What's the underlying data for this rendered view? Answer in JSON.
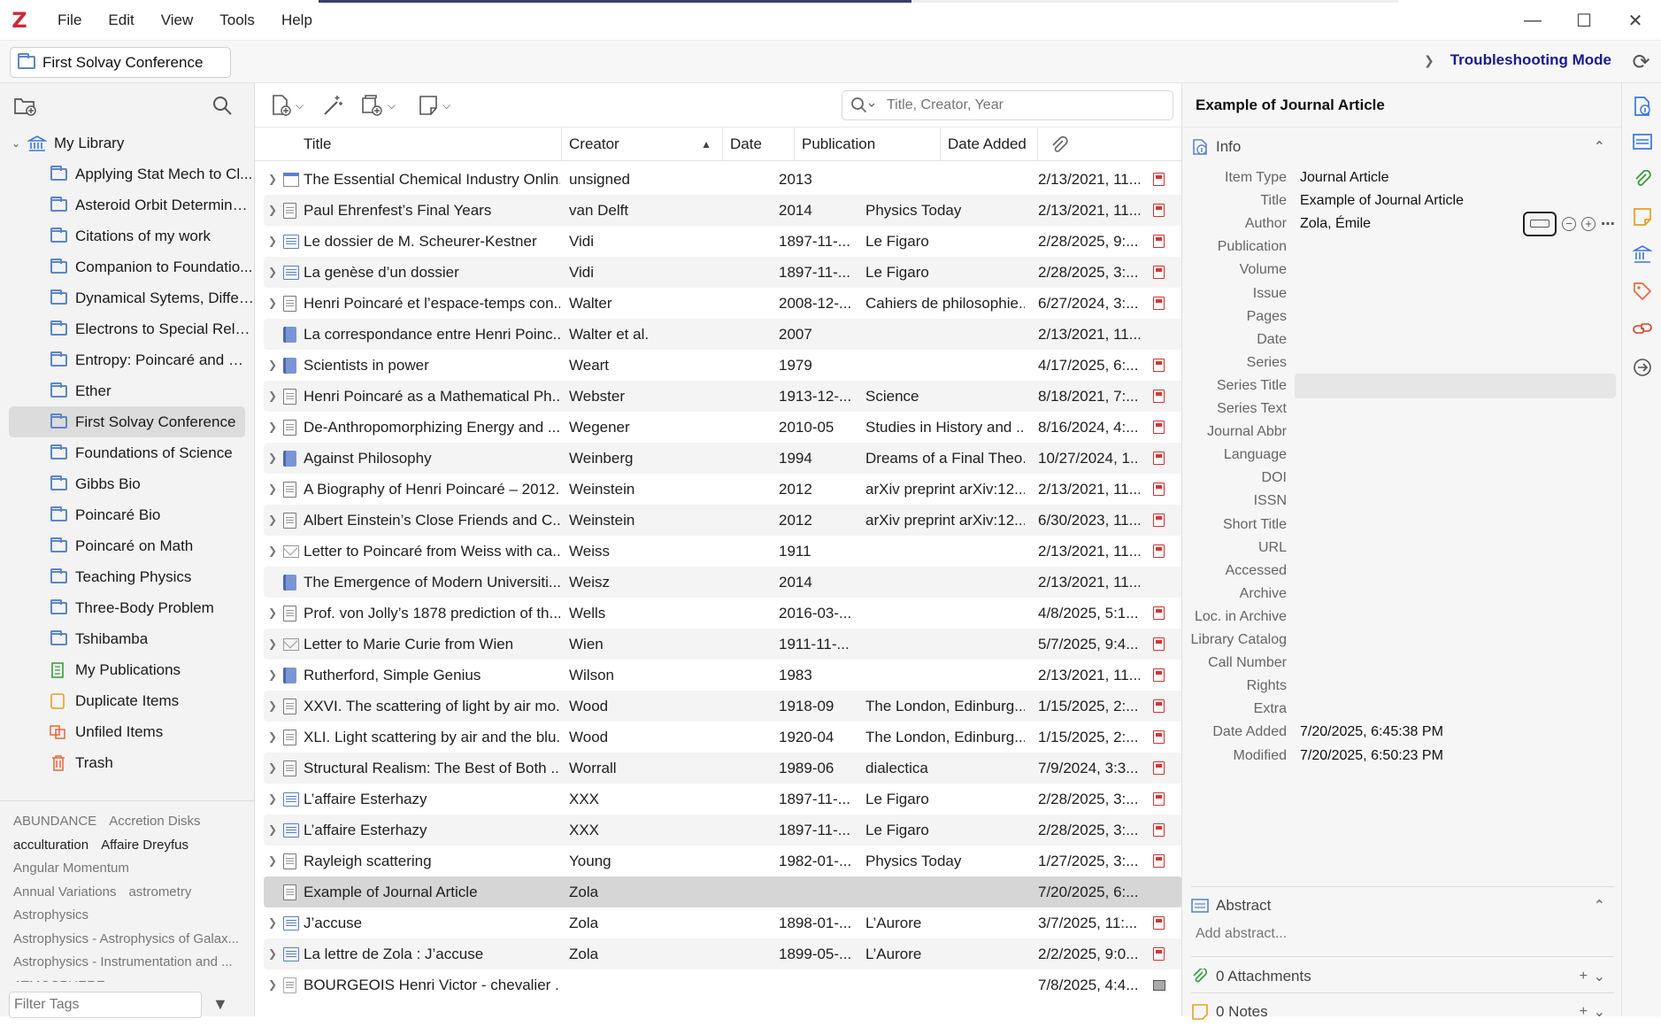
{
  "app": {
    "logo": "Z",
    "menu": [
      "File",
      "Edit",
      "View",
      "Tools",
      "Help"
    ]
  },
  "collection_bar": {
    "current": "First Solvay Conference",
    "mode": "Troubleshooting Mode"
  },
  "tree": [
    {
      "label": "My Library",
      "icon": "library-icon",
      "level": 0
    },
    {
      "label": "Applying Stat Mech to Cl...",
      "icon": "folder-icon",
      "level": 1
    },
    {
      "label": "Asteroid Orbit Determinat...",
      "icon": "folder-icon",
      "level": 1
    },
    {
      "label": "Citations of my work",
      "icon": "folder-icon",
      "level": 1
    },
    {
      "label": "Companion to Foundatio...",
      "icon": "folder-icon",
      "level": 1
    },
    {
      "label": "Dynamical Sytems, Differe...",
      "icon": "folder-icon",
      "level": 1
    },
    {
      "label": "Electrons to Special Relati...",
      "icon": "folder-icon",
      "level": 1
    },
    {
      "label": "Entropy: Poincaré and Gib...",
      "icon": "folder-icon",
      "level": 1
    },
    {
      "label": "Ether",
      "icon": "folder-icon",
      "level": 1
    },
    {
      "label": "First Solvay Conference",
      "icon": "folder-icon",
      "level": 1,
      "selected": true
    },
    {
      "label": "Foundations of Science",
      "icon": "folder-icon",
      "level": 1
    },
    {
      "label": "Gibbs Bio",
      "icon": "folder-icon",
      "level": 1
    },
    {
      "label": "Poincaré Bio",
      "icon": "folder-icon",
      "level": 1
    },
    {
      "label": "Poincaré on Math",
      "icon": "folder-icon",
      "level": 1
    },
    {
      "label": "Teaching Physics",
      "icon": "folder-icon",
      "level": 1
    },
    {
      "label": "Three-Body Problem",
      "icon": "folder-icon",
      "level": 1
    },
    {
      "label": "Tshibamba",
      "icon": "folder-icon",
      "level": 1
    },
    {
      "label": "My Publications",
      "icon": "publications-icon",
      "level": 1
    },
    {
      "label": "Duplicate Items",
      "icon": "duplicate-icon",
      "level": 1
    },
    {
      "label": "Unfiled Items",
      "icon": "unfiled-icon",
      "level": 1
    },
    {
      "label": "Trash",
      "icon": "trash-icon",
      "level": 1
    }
  ],
  "tags": [
    [
      {
        "t": "ABUNDANCE",
        "dark": false
      },
      {
        "t": "Accretion Disks",
        "dark": false
      }
    ],
    [
      {
        "t": "acculturation",
        "dark": true
      },
      {
        "t": "Affaire Dreyfus",
        "dark": true
      }
    ],
    [
      {
        "t": "Angular Momentum",
        "dark": false
      }
    ],
    [
      {
        "t": "Annual Variations",
        "dark": false
      },
      {
        "t": "astrometry",
        "dark": false
      }
    ],
    [
      {
        "t": "Astrophysics",
        "dark": false
      }
    ],
    [
      {
        "t": "Astrophysics - Astrophysics of Galax...",
        "dark": false
      }
    ],
    [
      {
        "t": "Astrophysics - Instrumentation and ...",
        "dark": false
      }
    ],
    [
      {
        "t": "ATMOSPHERE",
        "dark": false
      }
    ]
  ],
  "tag_filter": {
    "placeholder": "Filter Tags"
  },
  "search": {
    "placeholder": "Title, Creator, Year"
  },
  "columns": {
    "title": "Title",
    "creator": "Creator",
    "date": "Date",
    "publication": "Publication",
    "date_added": "Date Added"
  },
  "items": [
    {
      "type": "web",
      "title": "The Essential Chemical Industry Onlin...",
      "creator": "unsigned",
      "date": "2013",
      "pub": "",
      "added": "2/13/2021, 11...",
      "att": "pdf",
      "twisty": true
    },
    {
      "type": "doc",
      "title": "Paul Ehrenfest’s Final Years",
      "creator": "van Delft",
      "date": "2014",
      "pub": "Physics Today",
      "added": "2/13/2021, 11...",
      "att": "pdf",
      "twisty": true
    },
    {
      "type": "news",
      "title": "Le dossier de M. Scheurer-Kestner",
      "creator": "Vidi",
      "date": "1897-11-...",
      "pub": "Le Figaro",
      "added": "2/28/2025, 9:...",
      "att": "pdf",
      "twisty": true
    },
    {
      "type": "news",
      "title": "La genèse d’un dossier",
      "creator": "Vidi",
      "date": "1897-11-...",
      "pub": "Le Figaro",
      "added": "2/28/2025, 3:...",
      "att": "pdf",
      "twisty": true
    },
    {
      "type": "doc",
      "title": "Henri Poincaré et l’espace-temps con...",
      "creator": "Walter",
      "date": "2008-12-...",
      "pub": "Cahiers de philosophie...",
      "added": "6/27/2024, 3:...",
      "att": "pdf",
      "twisty": true
    },
    {
      "type": "book",
      "title": "La correspondance entre Henri Poinc...",
      "creator": "Walter et al.",
      "date": "2007",
      "pub": "",
      "added": "2/13/2021, 11...",
      "att": "",
      "twisty": false
    },
    {
      "type": "book",
      "title": "Scientists in power",
      "creator": "Weart",
      "date": "1979",
      "pub": "",
      "added": "4/17/2025, 6:...",
      "att": "pdf",
      "twisty": true
    },
    {
      "type": "doc",
      "title": "Henri Poincaré as a Mathematical Ph...",
      "creator": "Webster",
      "date": "1913-12-...",
      "pub": "Science",
      "added": "8/18/2021, 7:...",
      "att": "pdf",
      "twisty": true
    },
    {
      "type": "doc",
      "title": "De-Anthropomorphizing Energy and ...",
      "creator": "Wegener",
      "date": "2010-05",
      "pub": "Studies in History and ...",
      "added": "8/16/2024, 4:...",
      "att": "pdf",
      "twisty": true
    },
    {
      "type": "book",
      "title": "Against Philosophy",
      "creator": "Weinberg",
      "date": "1994",
      "pub": "Dreams of a Final Theo...",
      "added": "10/27/2024, 1...",
      "att": "pdf",
      "twisty": true
    },
    {
      "type": "doc",
      "title": "A Biography of Henri Poincaré – 2012...",
      "creator": "Weinstein",
      "date": "2012",
      "pub": "arXiv preprint arXiv:12...",
      "added": "2/13/2021, 11...",
      "att": "pdf",
      "twisty": true
    },
    {
      "type": "doc",
      "title": "Albert Einstein’s Close Friends and C...",
      "creator": "Weinstein",
      "date": "2012",
      "pub": "arXiv preprint arXiv:12...",
      "added": "6/30/2023, 11...",
      "att": "pdf",
      "twisty": true
    },
    {
      "type": "letter",
      "title": "Letter to Poincaré from Weiss with ca...",
      "creator": "Weiss",
      "date": "1911",
      "pub": "",
      "added": "2/13/2021, 11...",
      "att": "pdf",
      "twisty": true
    },
    {
      "type": "book",
      "title": "The Emergence of Modern Universiti...",
      "creator": "Weisz",
      "date": "2014",
      "pub": "",
      "added": "2/13/2021, 11...",
      "att": "",
      "twisty": false
    },
    {
      "type": "doc",
      "title": "Prof. von Jolly’s 1878 prediction of th...",
      "creator": "Wells",
      "date": "2016-03-...",
      "pub": "",
      "added": "4/8/2025, 5:1...",
      "att": "pdf",
      "twisty": true
    },
    {
      "type": "letter",
      "title": "Letter to Marie Curie from Wien",
      "creator": "Wien",
      "date": "1911-11-...",
      "pub": "",
      "added": "5/7/2025, 9:4...",
      "att": "pdf",
      "twisty": true
    },
    {
      "type": "book",
      "title": "Rutherford, Simple Genius",
      "creator": "Wilson",
      "date": "1983",
      "pub": "",
      "added": "2/13/2021, 11...",
      "att": "pdf",
      "twisty": true
    },
    {
      "type": "doc",
      "title": "XXVI. The scattering of light by air mo...",
      "creator": "Wood",
      "date": "1918-09",
      "pub": "The London, Edinburg...",
      "added": "1/15/2025, 2:...",
      "att": "pdf",
      "twisty": true
    },
    {
      "type": "doc",
      "title": "XLI. Light scattering by air and the blu...",
      "creator": "Wood",
      "date": "1920-04",
      "pub": "The London, Edinburg...",
      "added": "1/15/2025, 2:...",
      "att": "pdf",
      "twisty": true
    },
    {
      "type": "doc",
      "title": "Structural Realism: The Best of Both ...",
      "creator": "Worrall",
      "date": "1989-06",
      "pub": "dialectica",
      "added": "7/9/2024, 3:3...",
      "att": "pdf",
      "twisty": true
    },
    {
      "type": "news",
      "title": "L’affaire Esterhazy",
      "creator": "XXX",
      "date": "1897-11-...",
      "pub": "Le Figaro",
      "added": "2/28/2025, 3:...",
      "att": "pdf",
      "twisty": true
    },
    {
      "type": "news",
      "title": "L’affaire Esterhazy",
      "creator": "XXX",
      "date": "1897-11-...",
      "pub": "Le Figaro",
      "added": "2/28/2025, 3:...",
      "att": "pdf",
      "twisty": true
    },
    {
      "type": "doc",
      "title": "Rayleigh scattering",
      "creator": "Young",
      "date": "1982-01-...",
      "pub": "Physics Today",
      "added": "1/27/2025, 3:...",
      "att": "pdf",
      "twisty": true
    },
    {
      "type": "doc",
      "title": "Example of Journal Article",
      "creator": "Zola",
      "date": "",
      "pub": "",
      "added": "7/20/2025, 6:...",
      "att": "",
      "twisty": false,
      "selected": true
    },
    {
      "type": "news",
      "title": "J’accuse",
      "creator": "Zola",
      "date": "1898-01-...",
      "pub": "L’Aurore",
      "added": "3/7/2025, 11:...",
      "att": "pdf",
      "twisty": true
    },
    {
      "type": "news",
      "title": "La lettre de Zola : J’accuse",
      "creator": "Zola",
      "date": "1899-05-...",
      "pub": "L’Aurore",
      "added": "2/2/2025, 9:0...",
      "att": "pdf",
      "twisty": true
    },
    {
      "type": "blank",
      "title": "BOURGEOIS Henri Victor - chevalier ...",
      "creator": "",
      "date": "",
      "pub": "",
      "added": "7/8/2025, 4:4...",
      "att": "snapshot",
      "twisty": true
    }
  ],
  "item_pane": {
    "header": "Example of Journal Article",
    "info_label": "Info",
    "fields": [
      {
        "label": "Item Type",
        "value": "Journal Article"
      },
      {
        "label": "Title",
        "value": "Example of Journal Article"
      },
      {
        "label": "Author",
        "value": "Zola, Émile",
        "author": true
      },
      {
        "label": "Publication",
        "value": ""
      },
      {
        "label": "Volume",
        "value": ""
      },
      {
        "label": "Issue",
        "value": ""
      },
      {
        "label": "Pages",
        "value": ""
      },
      {
        "label": "Date",
        "value": ""
      },
      {
        "label": "Series",
        "value": ""
      },
      {
        "label": "Series Title",
        "value": "",
        "focused": true
      },
      {
        "label": "Series Text",
        "value": ""
      },
      {
        "label": "Journal Abbr",
        "value": ""
      },
      {
        "label": "Language",
        "value": ""
      },
      {
        "label": "DOI",
        "value": ""
      },
      {
        "label": "ISSN",
        "value": ""
      },
      {
        "label": "Short Title",
        "value": ""
      },
      {
        "label": "URL",
        "value": ""
      },
      {
        "label": "Accessed",
        "value": ""
      },
      {
        "label": "Archive",
        "value": ""
      },
      {
        "label": "Loc. in Archive",
        "value": ""
      },
      {
        "label": "Library Catalog",
        "value": ""
      },
      {
        "label": "Call Number",
        "value": ""
      },
      {
        "label": "Rights",
        "value": ""
      },
      {
        "label": "Extra",
        "value": ""
      },
      {
        "label": "Date Added",
        "value": "7/20/2025, 6:45:38 PM"
      },
      {
        "label": "Modified",
        "value": "7/20/2025, 6:50:23 PM"
      }
    ],
    "abstract_label": "Abstract",
    "abstract_placeholder": "Add abstract...",
    "attachments_label": "0 Attachments",
    "notes_label": "0 Notes"
  },
  "colors": {
    "accent": "#5b86c9",
    "mode_text": "#1a1a8c",
    "logo": "#cc2936",
    "pdf": "#cc3333"
  }
}
